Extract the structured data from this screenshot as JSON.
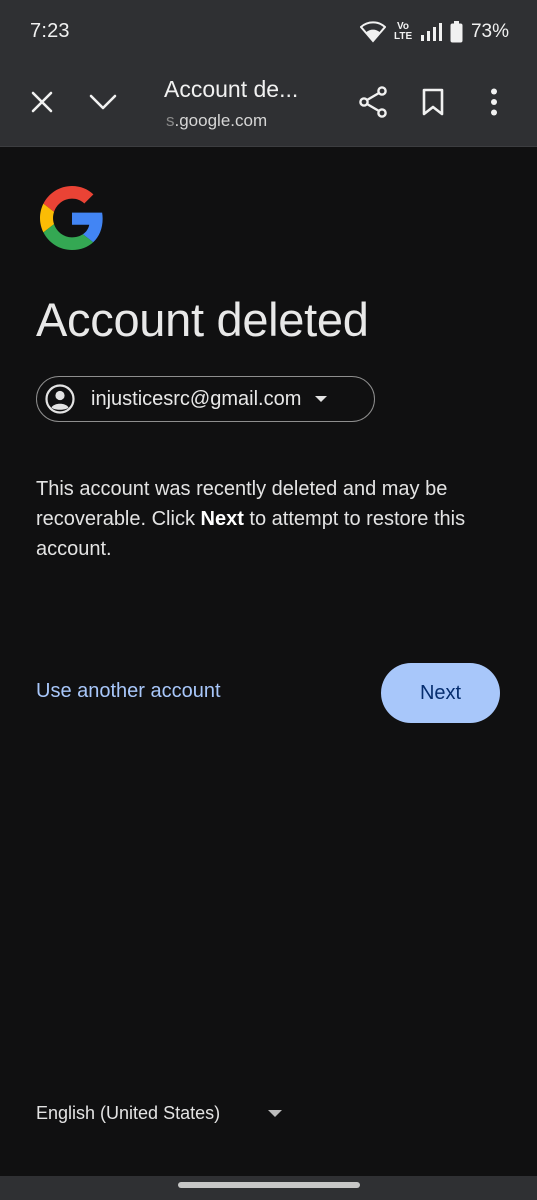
{
  "status_bar": {
    "time": "7:23",
    "volte": "Vo LTE",
    "battery": "73%"
  },
  "browser": {
    "title": "Account de...",
    "url_faded": "s",
    "url": ".google.com"
  },
  "page": {
    "heading": "Account deleted",
    "account_email": "injusticesrc@gmail.com",
    "description_part1": "This account was recently deleted and may be recoverable. Click ",
    "description_bold": "Next",
    "description_part2": " to attempt to restore this account.",
    "use_another_label": "Use another account",
    "next_label": "Next"
  },
  "footer": {
    "language": "English (United States)"
  },
  "colors": {
    "background": "#101011",
    "toolbar": "#2f3033",
    "accent": "#a8c7fa",
    "accent_text": "#062e6f"
  },
  "icons": [
    "close-icon",
    "chevron-down-icon",
    "share-icon",
    "bookmark-icon",
    "more-vert-icon",
    "google-logo",
    "account-circle-icon",
    "wifi-icon",
    "signal-icon",
    "battery-icon"
  ]
}
